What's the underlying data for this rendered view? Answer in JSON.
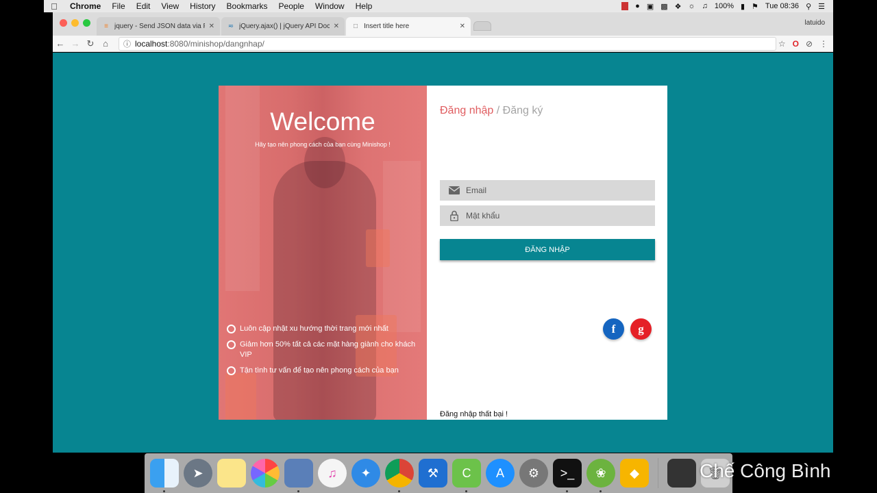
{
  "menubar": {
    "app": "Chrome",
    "items": [
      "File",
      "Edit",
      "View",
      "History",
      "Bookmarks",
      "People",
      "Window",
      "Help"
    ],
    "battery": "100%",
    "clock": "Tue 08:36"
  },
  "browser": {
    "tabs": [
      {
        "title": "jquery - Send JSON data via P"
      },
      {
        "title": "jQuery.ajax() | jQuery API Docu"
      },
      {
        "title": "Insert title here"
      }
    ],
    "profile": "latuido",
    "url_host": "localhost",
    "url_path": ":8080/minishop/dangnhap/"
  },
  "hero": {
    "title": "Welcome",
    "tagline": "Hãy tạo nên phong cách của bạn cùng Minishop !",
    "features": [
      "Luôn cập nhật xu hướng thời trang mới nhất",
      "Giảm hơn 50% tất cả các mặt hàng giành cho khách VIP",
      "Tận tình tư vấn để tạo nên phong cách của bạn"
    ]
  },
  "form": {
    "tab_login": "Đăng nhập",
    "separator": "/",
    "tab_register": "Đăng ký",
    "email_placeholder": "Email",
    "password_placeholder": "Mật khẩu",
    "login_button": "ĐĂNG NHẬP",
    "facebook_label": "f",
    "google_label": "g",
    "status_message": "Đăng nhập thất bại !"
  },
  "watermark": "Chế Công Bình",
  "colors": {
    "page_bg": "#078591",
    "accent_red": "#e05d60",
    "facebook": "#1565c0",
    "google": "#e52027"
  }
}
